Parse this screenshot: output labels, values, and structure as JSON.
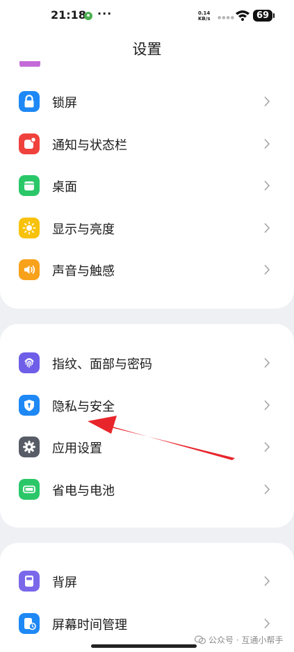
{
  "status_bar": {
    "time": "21:18",
    "more": "···",
    "net_speed": "0.14 KB/s",
    "signal": "●●●●",
    "battery": "69"
  },
  "header": {
    "title": "设置"
  },
  "sections": [
    {
      "items": [
        {
          "label": "锁屏",
          "icon": "lock-icon",
          "color": "#1e88f5"
        },
        {
          "label": "通知与状态栏",
          "icon": "notification-icon",
          "color": "#f0423c"
        },
        {
          "label": "桌面",
          "icon": "desktop-icon",
          "color": "#2ac769"
        },
        {
          "label": "显示与亮度",
          "icon": "brightness-icon",
          "color": "#f8c20c"
        },
        {
          "label": "声音与触感",
          "icon": "sound-icon",
          "color": "#f8a11a"
        }
      ]
    },
    {
      "items": [
        {
          "label": "指纹、面部与密码",
          "icon": "fingerprint-icon",
          "color": "#6f5ee8"
        },
        {
          "label": "隐私与安全",
          "icon": "shield-icon",
          "color": "#1e88f5"
        },
        {
          "label": "应用设置",
          "icon": "gear-icon",
          "color": "#575c66"
        },
        {
          "label": "省电与电池",
          "icon": "battery-icon",
          "color": "#2ac769"
        }
      ]
    },
    {
      "items": [
        {
          "label": "背屏",
          "icon": "back-screen-icon",
          "color": "#7a68ea"
        },
        {
          "label": "屏幕时间管理",
          "icon": "screen-time-icon",
          "color": "#1e88f5"
        }
      ]
    }
  ],
  "annotation": {
    "arrow_color": "#e8252b"
  },
  "watermark": {
    "text": "公众号 · 互通小帮手"
  }
}
